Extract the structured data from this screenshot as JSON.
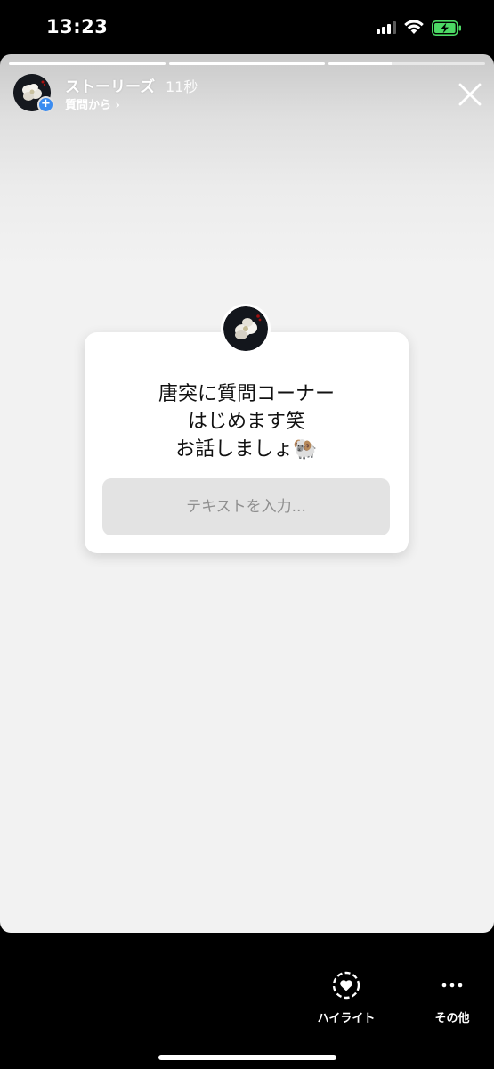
{
  "status_bar": {
    "time": "13:23",
    "icons": [
      "signal-icon",
      "wifi-icon",
      "battery-charging-icon"
    ],
    "battery_color": "#4cd964"
  },
  "story": {
    "progress_segments": [
      1.0,
      1.0,
      0.4
    ],
    "username": "ストーリーズ",
    "time_ago": "11秒",
    "subtitle": "質問から ›",
    "close_icon": "close-icon"
  },
  "sticker": {
    "lines": [
      "唐突に質問コーナー",
      "はじめます笑",
      "お話しましょ🐏"
    ],
    "input_placeholder": "テキストを入力..."
  },
  "actions": {
    "highlight_label": "ハイライト",
    "more_label": "その他"
  },
  "colors": {
    "background": "#000000",
    "story_background": "#f2f2f2",
    "input_background": "#e3e3e3",
    "accent_blue": "#3b8cf0"
  }
}
